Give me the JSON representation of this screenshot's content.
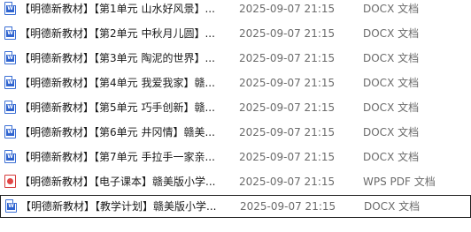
{
  "colors": {
    "docx_icon": "#2f64d0",
    "pdf_icon": "#e04545",
    "meta_text": "#6b6b6b",
    "selection_border": "#1f1f1f"
  },
  "files": [
    {
      "name": "【明德新教材】【第1单元 山水好风景】...",
      "date": "2025-09-07 21:15",
      "type": "DOCX 文档",
      "icon": "docx-icon"
    },
    {
      "name": "【明德新教材】【第2单元 中秋月儿圆】...",
      "date": "2025-09-07 21:15",
      "type": "DOCX 文档",
      "icon": "docx-icon"
    },
    {
      "name": "【明德新教材】【第3单元 陶泥的世界】...",
      "date": "2025-09-07 21:15",
      "type": "DOCX 文档",
      "icon": "docx-icon"
    },
    {
      "name": "【明德新教材】【第4单元 我爱我家】赣...",
      "date": "2025-09-07 21:15",
      "type": "DOCX 文档",
      "icon": "docx-icon"
    },
    {
      "name": "【明德新教材】【第5单元 巧手创新】赣...",
      "date": "2025-09-07 21:15",
      "type": "DOCX 文档",
      "icon": "docx-icon"
    },
    {
      "name": "【明德新教材】【第6单元 井冈情】赣美...",
      "date": "2025-09-07 21:15",
      "type": "DOCX 文档",
      "icon": "docx-icon"
    },
    {
      "name": "【明德新教材】【第7单元 手拉手一家亲...",
      "date": "2025-09-07 21:15",
      "type": "DOCX 文档",
      "icon": "docx-icon"
    },
    {
      "name": "【明德新教材】【电子课本】赣美版小学...",
      "date": "2025-09-07 21:15",
      "type": "WPS PDF 文档",
      "icon": "pdf-icon"
    },
    {
      "name": "【明德新教材】【教学计划】赣美版小学...",
      "date": "2025-09-07 21:15",
      "type": "DOCX 文档",
      "icon": "docx-icon",
      "selected": true
    }
  ]
}
